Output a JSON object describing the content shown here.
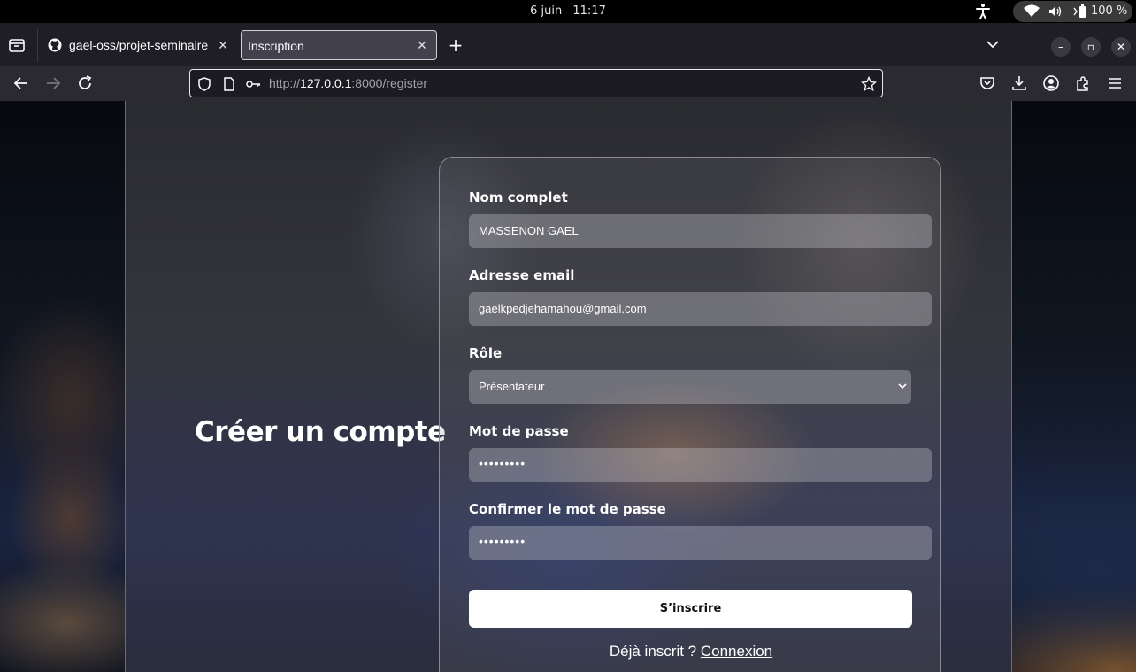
{
  "system_bar": {
    "date": "6 juin",
    "time": "11:17",
    "battery": "100 %"
  },
  "browser": {
    "tabs": [
      {
        "title": "gael-oss/projet-seminaire",
        "active": false
      },
      {
        "title": "Inscription",
        "active": true
      }
    ],
    "url": {
      "scheme": "http://",
      "host": "127.0.0.1",
      "rest": ":8000/register"
    }
  },
  "page": {
    "heading": "Créer un compte",
    "form": {
      "name_label": "Nom complet",
      "name_value": "MASSENON GAEL",
      "email_label": "Adresse email",
      "email_value": "gaelkpedjehamahou@gmail.com",
      "role_label": "Rôle",
      "role_value": "Présentateur",
      "password_label": "Mot de passe",
      "password_value": "•••••••••",
      "confirm_label": "Confirmer le mot de passe",
      "confirm_value": "•••••••••",
      "submit_label": "S’inscrire",
      "footer_text": "Déjà inscrit ?",
      "footer_link": "Connexion"
    }
  },
  "colors": {
    "browser_chrome": "#2b2a33",
    "tab_strip": "#1f1e25",
    "submit_bg": "#ffffff",
    "text": "#ffffff"
  }
}
